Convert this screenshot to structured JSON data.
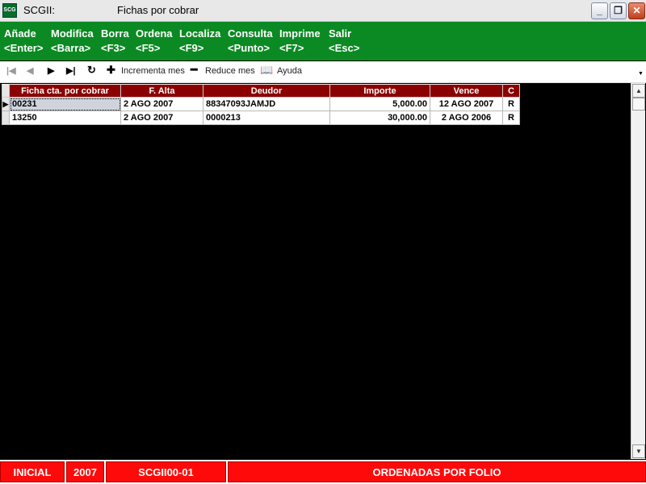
{
  "window": {
    "app_title": "SCGII:",
    "doc_title": "Fichas por cobrar",
    "minimize": "_",
    "maximize": "❐",
    "close": "✕"
  },
  "menu": [
    {
      "label": "Añade",
      "key": "<Enter>"
    },
    {
      "label": "Modifica",
      "key": "<Barra>"
    },
    {
      "label": "Borra",
      "key": "<F3>"
    },
    {
      "label": "Ordena",
      "key": "<F5>"
    },
    {
      "label": "Localiza",
      "key": "<F9>"
    },
    {
      "label": "Consulta",
      "key": "<Punto>"
    },
    {
      "label": "Imprime",
      "key": "<F7>"
    },
    {
      "label": "Salir",
      "key": "<Esc>"
    }
  ],
  "toolbar": {
    "first_icon": "first-record-icon",
    "prev_icon": "prev-record-icon",
    "next_icon": "next-record-icon",
    "last_icon": "last-record-icon",
    "refresh_icon": "refresh-icon",
    "increase_label": "Incrementa mes",
    "decrease_label": "Reduce mes",
    "help_label": "Ayuda"
  },
  "table": {
    "columns": [
      "Ficha cta. por cobrar",
      "F. Alta",
      "Deudor",
      "Importe",
      "Vence",
      "C"
    ],
    "rows": [
      [
        "00231",
        "2 AGO 2007",
        "88347093JAMJD",
        "5,000.00",
        "12 AGO 2007",
        "R"
      ],
      [
        "13250",
        "2 AGO 2007",
        "0000213",
        "30,000.00",
        "2 AGO 2006",
        "R"
      ]
    ]
  },
  "status": {
    "mode": "INICIAL",
    "year": "2007",
    "screen_code": "SCGII00-01",
    "order": "ORDENADAS POR FOLIO"
  },
  "colors": {
    "menubar": "#0b8a23",
    "header": "#8b0000",
    "statusbar": "#ff0a0a"
  }
}
